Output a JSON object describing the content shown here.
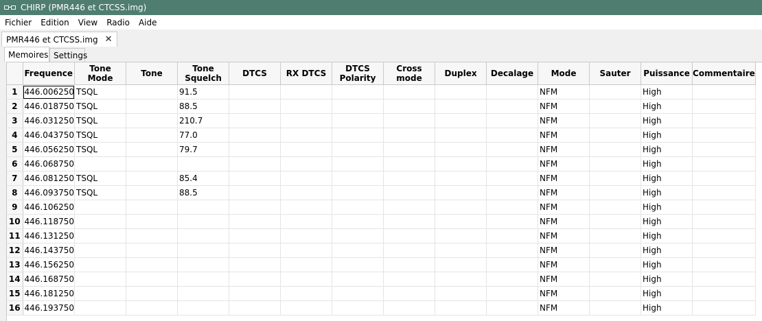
{
  "window": {
    "title": "CHIRP (PMR446 et CTCSS.img)"
  },
  "menu": [
    "Fichier",
    "Edition",
    "View",
    "Radio",
    "Aide"
  ],
  "file_tab": {
    "label": "PMR446 et CTCSS.img"
  },
  "tabs": [
    "Memoires",
    "Settings"
  ],
  "columns": [
    "Frequence",
    "Tone\nMode",
    "Tone",
    "Tone\nSquelch",
    "DTCS",
    "RX DTCS",
    "DTCS\nPolarity",
    "Cross mode",
    "Duplex",
    "Decalage",
    "Mode",
    "Sauter",
    "Puissance",
    "Commentaire"
  ],
  "rows": [
    {
      "num": "1",
      "frequence": "446.006250",
      "tone_mode": "TSQL",
      "tone_squelch": "91.5",
      "mode": "NFM",
      "puissance": "High"
    },
    {
      "num": "2",
      "frequence": "446.018750",
      "tone_mode": "TSQL",
      "tone_squelch": "88.5",
      "mode": "NFM",
      "puissance": "High"
    },
    {
      "num": "3",
      "frequence": "446.031250",
      "tone_mode": "TSQL",
      "tone_squelch": "210.7",
      "mode": "NFM",
      "puissance": "High"
    },
    {
      "num": "4",
      "frequence": "446.043750",
      "tone_mode": "TSQL",
      "tone_squelch": "77.0",
      "mode": "NFM",
      "puissance": "High"
    },
    {
      "num": "5",
      "frequence": "446.056250",
      "tone_mode": "TSQL",
      "tone_squelch": "79.7",
      "mode": "NFM",
      "puissance": "High"
    },
    {
      "num": "6",
      "frequence": "446.068750",
      "tone_mode": "",
      "tone_squelch": "",
      "mode": "NFM",
      "puissance": "High"
    },
    {
      "num": "7",
      "frequence": "446.081250",
      "tone_mode": "TSQL",
      "tone_squelch": "85.4",
      "mode": "NFM",
      "puissance": "High"
    },
    {
      "num": "8",
      "frequence": "446.093750",
      "tone_mode": "TSQL",
      "tone_squelch": "88.5",
      "mode": "NFM",
      "puissance": "High"
    },
    {
      "num": "9",
      "frequence": "446.106250",
      "tone_mode": "",
      "tone_squelch": "",
      "mode": "NFM",
      "puissance": "High"
    },
    {
      "num": "10",
      "frequence": "446.118750",
      "tone_mode": "",
      "tone_squelch": "",
      "mode": "NFM",
      "puissance": "High"
    },
    {
      "num": "11",
      "frequence": "446.131250",
      "tone_mode": "",
      "tone_squelch": "",
      "mode": "NFM",
      "puissance": "High"
    },
    {
      "num": "12",
      "frequence": "446.143750",
      "tone_mode": "",
      "tone_squelch": "",
      "mode": "NFM",
      "puissance": "High"
    },
    {
      "num": "13",
      "frequence": "446.156250",
      "tone_mode": "",
      "tone_squelch": "",
      "mode": "NFM",
      "puissance": "High"
    },
    {
      "num": "14",
      "frequence": "446.168750",
      "tone_mode": "",
      "tone_squelch": "",
      "mode": "NFM",
      "puissance": "High"
    },
    {
      "num": "15",
      "frequence": "446.181250",
      "tone_mode": "",
      "tone_squelch": "",
      "mode": "NFM",
      "puissance": "High"
    },
    {
      "num": "16",
      "frequence": "446.193750",
      "tone_mode": "",
      "tone_squelch": "",
      "mode": "NFM",
      "puissance": "High"
    }
  ]
}
